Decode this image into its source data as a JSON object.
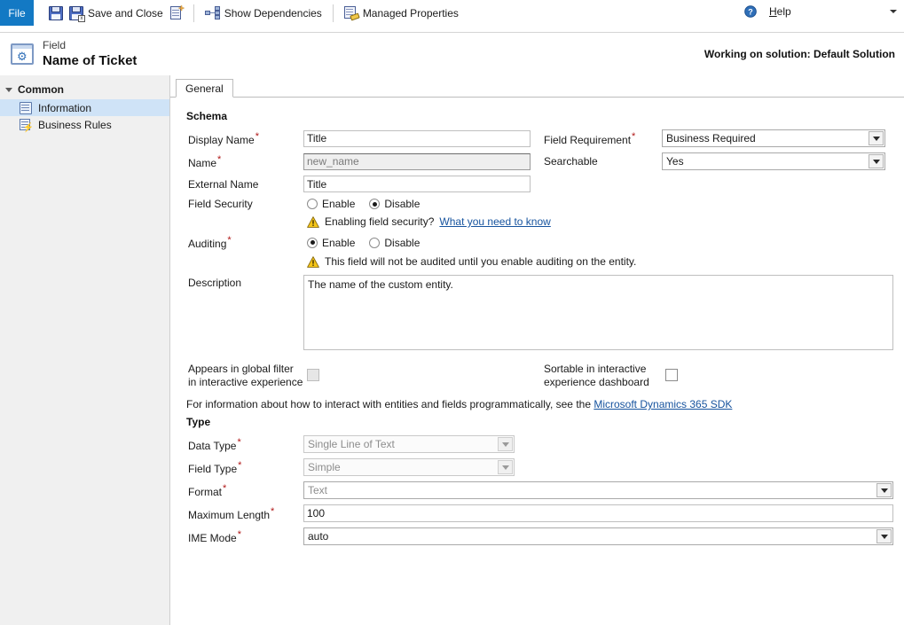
{
  "ribbon": {
    "file_tab": "File",
    "save_icon_name": "save-icon",
    "save_and_close_label": "Save and Close",
    "new_icon_name": "new-field-icon",
    "show_dependencies_label": "Show Dependencies",
    "managed_properties_label": "Managed Properties",
    "help_label_pre": "",
    "help_label_accel": "H",
    "help_label_post": "elp"
  },
  "header": {
    "kicker": "Field",
    "title": "Name of Ticket",
    "solution_note": "Working on solution: Default Solution"
  },
  "sidebar": {
    "group_label": "Common",
    "items": [
      {
        "label": "Information",
        "selected": true
      },
      {
        "label": "Business Rules",
        "selected": false
      }
    ]
  },
  "tabs": [
    {
      "label": "General",
      "active": true
    }
  ],
  "schema": {
    "section_title": "Schema",
    "display_name_label": "Display Name",
    "display_name_value": "Title",
    "name_label": "Name",
    "name_value": "new_name",
    "external_name_label": "External Name",
    "external_name_value": "Title",
    "field_requirement_label": "Field Requirement",
    "field_requirement_value": "Business Required",
    "searchable_label": "Searchable",
    "searchable_value": "Yes",
    "field_security_label": "Field Security",
    "field_security_enable": "Enable",
    "field_security_disable": "Disable",
    "field_security_selected": "Disable",
    "field_security_note_text": "Enabling field security?",
    "field_security_note_link": "What you need to know",
    "auditing_label": "Auditing",
    "auditing_enable": "Enable",
    "auditing_disable": "Disable",
    "auditing_selected": "Enable",
    "auditing_note": "This field will not be audited until you enable auditing on the entity.",
    "description_label": "Description",
    "description_value": "The name of the custom entity.",
    "global_filter_label": "Appears in global filter in interactive experience",
    "global_filter_checked": false,
    "global_filter_disabled": true,
    "sortable_label": "Sortable in interactive experience dashboard",
    "sortable_checked": false,
    "sortable_disabled": false,
    "sdk_text": "For information about how to interact with entities and fields programmatically, see the",
    "sdk_link": "Microsoft Dynamics 365 SDK"
  },
  "type": {
    "section_title": "Type",
    "data_type_label": "Data Type",
    "data_type_value": "Single Line of Text",
    "field_type_label": "Field Type",
    "field_type_value": "Simple",
    "format_label": "Format",
    "format_value": "Text",
    "maximum_length_label": "Maximum Length",
    "maximum_length_value": "100",
    "ime_mode_label": "IME Mode",
    "ime_mode_value": "auto"
  },
  "colors": {
    "file_tab_blue": "#1379c4",
    "link_blue": "#16539e",
    "required_red": "#b01717",
    "selected_nav": "#cfe3f7",
    "warning_yellow": "#f5c518"
  }
}
